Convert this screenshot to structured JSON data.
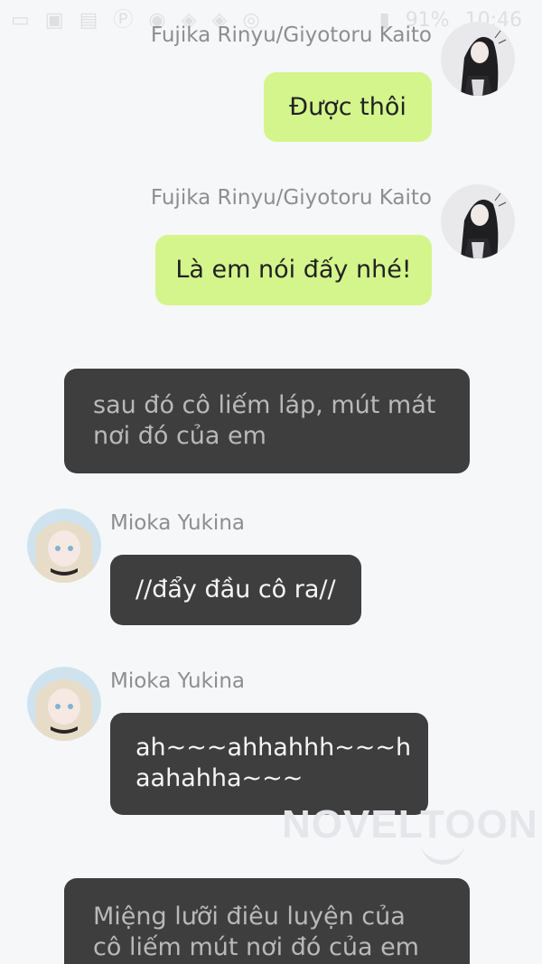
{
  "status_bar": {
    "left_icons": [
      "chat-icon",
      "image-icon",
      "message-icon",
      "pinterest-icon",
      "game-icon",
      "app-icon",
      "app-icon",
      "app-icon"
    ],
    "battery": "91%",
    "time": "10:46"
  },
  "messages": [
    {
      "type": "outgoing",
      "sender": "Fujika Rinyu/Giyotoru Kaito",
      "text": "Được thôi"
    },
    {
      "type": "outgoing",
      "sender": "Fujika Rinyu/Giyotoru Kaito",
      "text": "Là em nói đấy nhé!"
    },
    {
      "type": "narration",
      "text": "sau đó cô liếm láp, mút mát nơi đó của em"
    },
    {
      "type": "incoming",
      "sender": "Mioka Yukina",
      "text": "//đẩy đầu cô ra//"
    },
    {
      "type": "incoming",
      "sender": "Mioka Yukina",
      "text": "ah~~~ahhahhh~~~h\naahahha~~~"
    },
    {
      "type": "narration",
      "text": "Miệng lưỡi điêu luyện của cô liếm mút nơi đó của em"
    }
  ],
  "watermark": "NOVELTOON",
  "colors": {
    "background": "#f6f7f9",
    "outgoing_bubble": "#d4f58c",
    "incoming_bubble": "#3e3e3e",
    "narration_text": "#b9b9b9",
    "name_text": "#8e8e8e"
  }
}
